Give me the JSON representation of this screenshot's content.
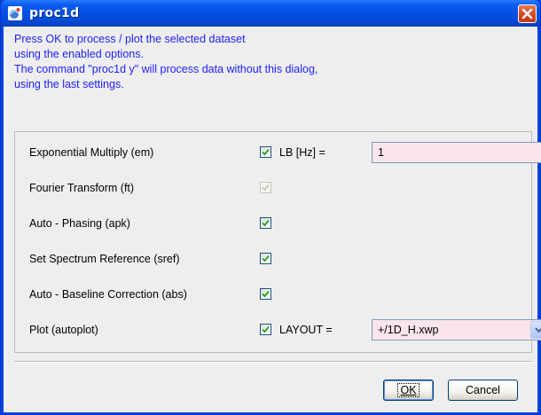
{
  "window": {
    "title": "proc1d",
    "icon": "app-icon",
    "close_icon": "close-icon"
  },
  "info_lines": [
    "Press OK to process / plot the selected dataset",
    "using the enabled options.",
    "The command \"proc1d y\" will process data without this dialog,",
    "using the last settings."
  ],
  "options": [
    {
      "label": "Exponential Multiply (em)",
      "checked": true,
      "enabled": true
    },
    {
      "label": "Fourier Transform (ft)",
      "checked": true,
      "enabled": false
    },
    {
      "label": "Auto - Phasing (apk)",
      "checked": true,
      "enabled": true
    },
    {
      "label": "Set Spectrum Reference (sref)",
      "checked": true,
      "enabled": true
    },
    {
      "label": "Auto - Baseline Correction (abs)",
      "checked": true,
      "enabled": true
    },
    {
      "label": "Plot (autoplot)",
      "checked": true,
      "enabled": true
    }
  ],
  "lb": {
    "label": "LB [Hz] =",
    "value": "1"
  },
  "layout": {
    "label": "LAYOUT =",
    "value": "+/1D_H.xwp"
  },
  "buttons": {
    "ok_label": "OK",
    "cancel_label": "Cancel"
  },
  "colors": {
    "info_text": "#1d1ff2",
    "field_background": "#fbe5ea",
    "title_bar": "#0551e4"
  }
}
